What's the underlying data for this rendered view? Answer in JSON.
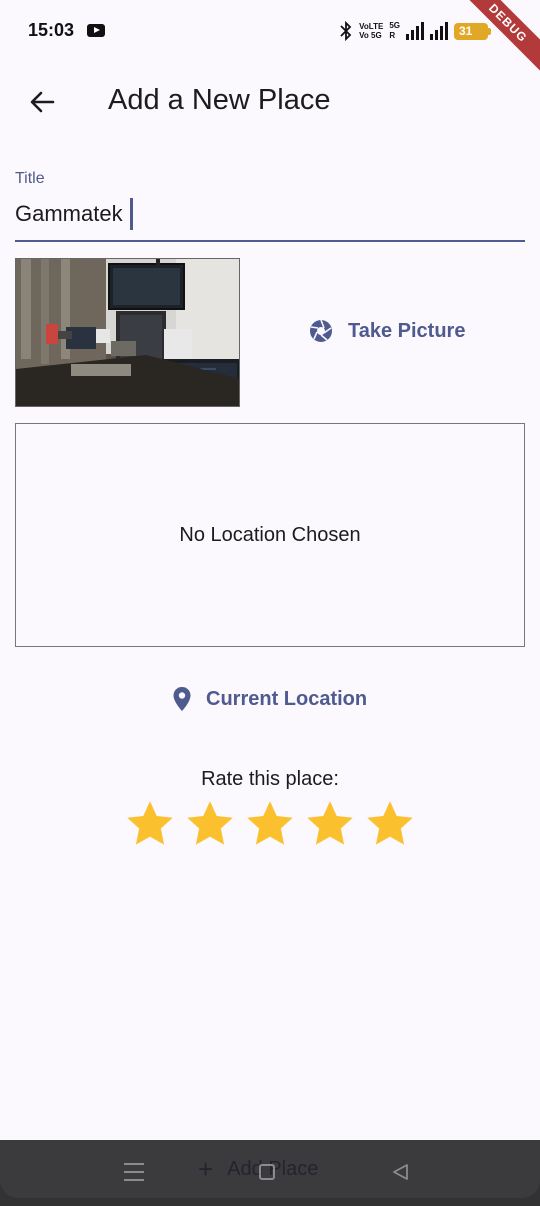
{
  "status_bar": {
    "time": "15:03",
    "network_volte": "VoLTE",
    "network_vo5g": "Vo 5G",
    "network_5g": "5G",
    "network_r": "R",
    "battery": "31",
    "debug_banner": "DEBUG"
  },
  "app_bar": {
    "title": "Add a New Place",
    "back_icon": "arrow-back-icon"
  },
  "title_field": {
    "label": "Title",
    "value": "Gammatek"
  },
  "image_input": {
    "button_label": "Take Picture",
    "icon": "camera-shutter-icon"
  },
  "location": {
    "placeholder": "No Location Chosen",
    "button_label": "Current Location",
    "icon": "location-pin-icon"
  },
  "rating": {
    "label": "Rate this place:",
    "value": 5,
    "max": 5,
    "star_color": "#fbc02d"
  },
  "bottom": {
    "add_label": "Add Place",
    "add_icon": "plus-icon"
  },
  "colors": {
    "accent": "#4f5a8f",
    "background": "#fbf8fe",
    "star": "#fbc02d"
  }
}
